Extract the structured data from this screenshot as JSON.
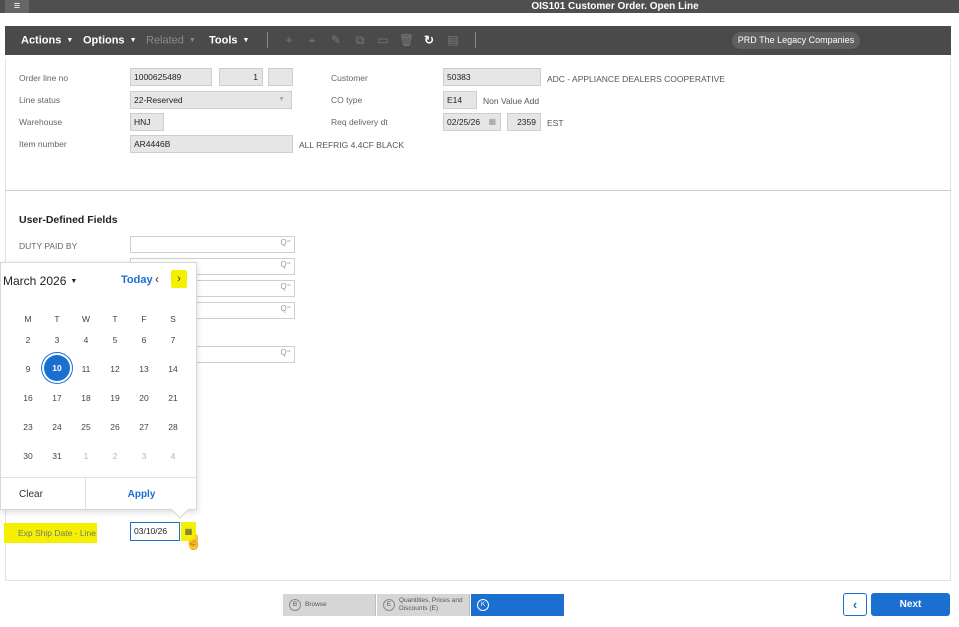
{
  "window": {
    "title": "OIS101 Customer Order. Open Line",
    "menu_icon": "hamburger-icon"
  },
  "toolbar": {
    "menus": [
      {
        "label": "Actions",
        "enabled": true
      },
      {
        "label": "Options",
        "enabled": true
      },
      {
        "label": "Related",
        "enabled": false
      },
      {
        "label": "Tools",
        "enabled": true
      }
    ],
    "icons": [
      "add-icon",
      "pin-icon",
      "edit-icon",
      "copy-icon",
      "save-icon",
      "delete-icon",
      "refresh-icon",
      "display-icon"
    ],
    "environment": "PRD The Legacy Companies"
  },
  "header": {
    "order_line_label": "Order line no",
    "order_no": "1000625489",
    "line_no": "1",
    "line_suffix": "",
    "line_status_label": "Line status",
    "line_status": "22-Reserved",
    "warehouse_label": "Warehouse",
    "warehouse": "HNJ",
    "item_number_label": "Item number",
    "item_number": "AR4446B",
    "item_description": "ALL REFRIG 4.4CF BLACK",
    "customer_label": "Customer",
    "customer": "50383",
    "customer_name": "ADC - APPLIANCE DEALERS COOPERATIVE",
    "co_type_label": "CO type",
    "co_type": "E14",
    "co_type_desc": "Non Value Add",
    "req_delivery_label": "Req delivery dt",
    "req_delivery_date": "02/25/26",
    "req_delivery_time": "2359",
    "req_delivery_tz": "EST"
  },
  "udf": {
    "title": "User-Defined Fields",
    "duty_paid_label": "DUTY PAID BY",
    "exp_ship_label": "Exp Ship Date - Line",
    "exp_ship_value": "03/10/26"
  },
  "calendar": {
    "month_label": "March 2026",
    "today_label": "Today",
    "prev_icon": "‹",
    "next_icon": "›",
    "dow": [
      "M",
      "T",
      "W",
      "T",
      "F",
      "S"
    ],
    "weeks": [
      [
        "2",
        "3",
        "4",
        "5",
        "6",
        "7"
      ],
      [
        "9",
        "10",
        "11",
        "12",
        "13",
        "14"
      ],
      [
        "16",
        "17",
        "18",
        "19",
        "20",
        "21"
      ],
      [
        "23",
        "24",
        "25",
        "26",
        "27",
        "28"
      ],
      [
        "30",
        "31",
        "1",
        "2",
        "3",
        "4"
      ]
    ],
    "selected_day": "10",
    "clear_label": "Clear",
    "apply_label": "Apply"
  },
  "bottom_nav": {
    "steps": [
      {
        "letter": "B",
        "label": "Browse"
      },
      {
        "letter": "E",
        "label_line1": "Quantities, Prices and",
        "label_line2": "Discounts (E)"
      },
      {
        "letter": "K",
        "label": ""
      }
    ],
    "back_icon": "‹",
    "next_label": "Next"
  }
}
